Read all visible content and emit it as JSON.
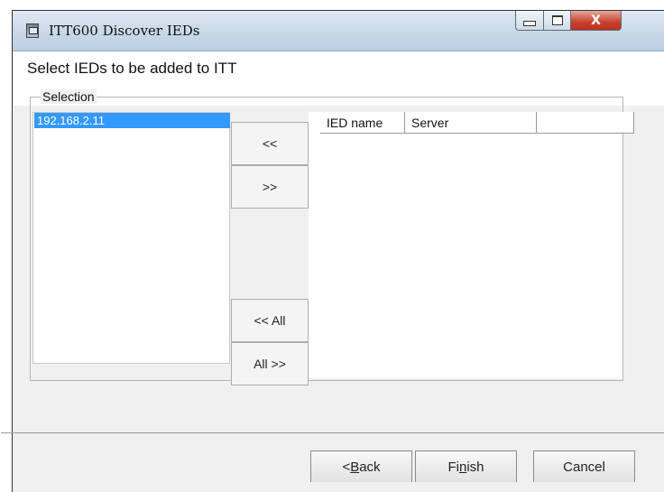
{
  "window": {
    "title": "ITT600 Discover IEDs",
    "controls": {
      "minimize": "minimize",
      "maximize": "maximize",
      "close": "X"
    }
  },
  "wizard": {
    "heading": "Select IEDs to be added to ITT",
    "group_label": "Selection"
  },
  "available_list": {
    "items": [
      "192.168.2.11"
    ],
    "selected_index": 0
  },
  "move_buttons": {
    "move_left": "<<",
    "move_right": ">>",
    "move_all_left": "<< All",
    "move_all_right": "All >>"
  },
  "selected_table": {
    "columns": [
      "IED name",
      "Server",
      ""
    ],
    "rows": []
  },
  "footer": {
    "back_prefix": "< ",
    "back_underline": "B",
    "back_rest": "ack",
    "finish_pre": "Fi",
    "finish_underline": "n",
    "finish_rest": "ish",
    "cancel": "Cancel"
  },
  "colors": {
    "selection": "#3399ff",
    "close_button": "#c8402d",
    "titlebar": "#c9d8e8"
  }
}
